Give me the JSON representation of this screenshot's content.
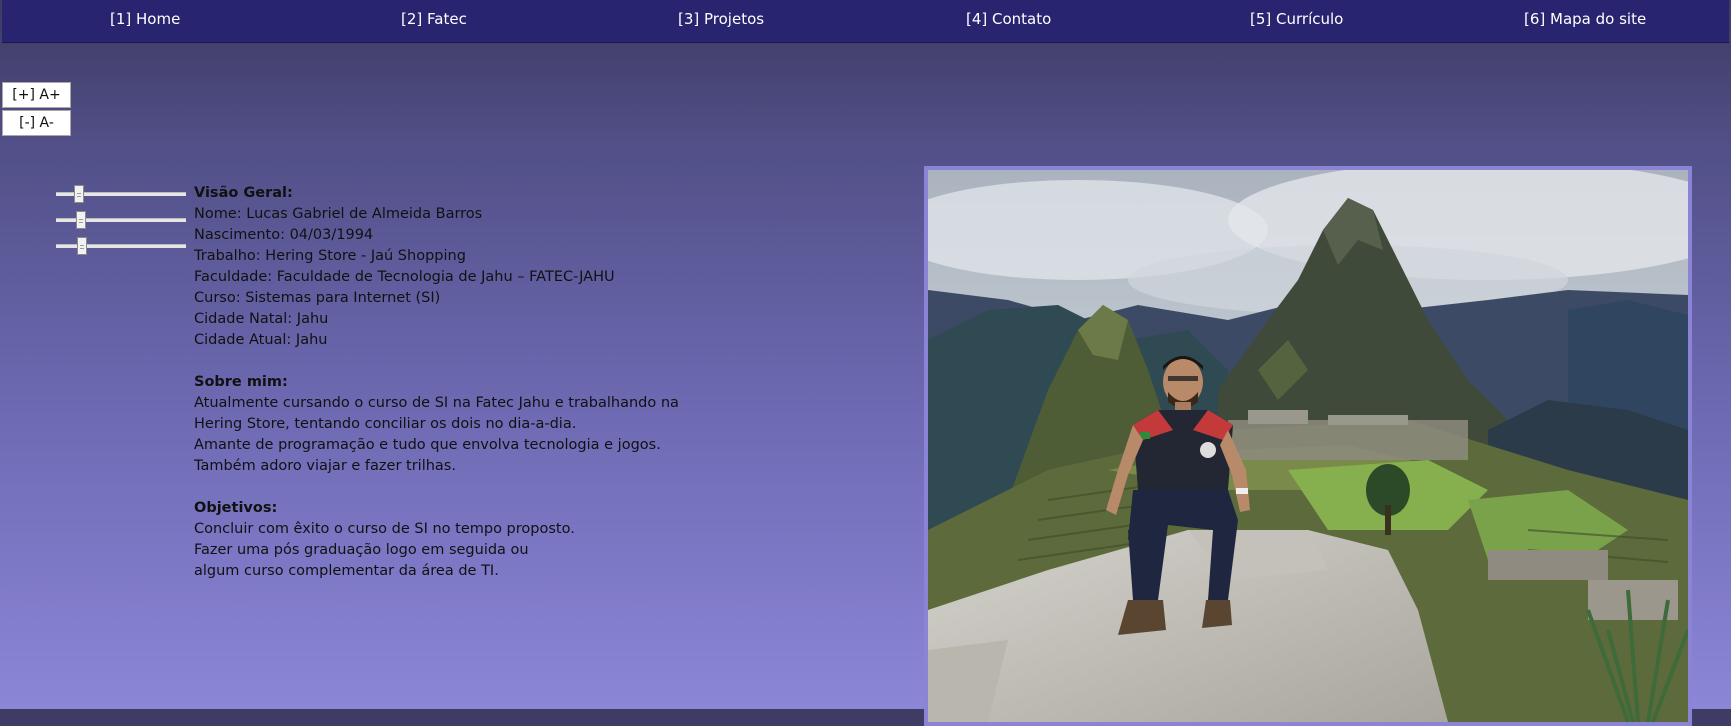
{
  "nav": {
    "items": [
      {
        "label": "[1] Home"
      },
      {
        "label": "[2] Fatec"
      },
      {
        "label": "[3] Projetos"
      },
      {
        "label": "[4] Contato"
      },
      {
        "label": "[5] Currículo"
      },
      {
        "label": "[6] Mapa do site"
      }
    ]
  },
  "font_controls": {
    "increase_label": "[+] A+",
    "decrease_label": "[-] A-"
  },
  "sliders": [
    {
      "value": 0.18
    },
    {
      "value": 0.19
    },
    {
      "value": 0.2
    }
  ],
  "overview": {
    "heading": "Visão Geral:",
    "lines": [
      "Nome: Lucas Gabriel de Almeida Barros",
      "Nascimento: 04/03/1994",
      "Trabalho: Hering Store - Jaú Shopping",
      "Faculdade: Faculdade de Tecnologia de Jahu – FATEC-JAHU",
      "Curso: Sistemas para Internet (SI)",
      "Cidade Natal: Jahu",
      "Cidade Atual: Jahu"
    ]
  },
  "about": {
    "heading": "Sobre mim:",
    "lines": [
      "Atualmente cursando o curso de SI na Fatec Jahu e trabalhando na",
      "Hering Store, tentando conciliar os dois no dia-a-dia.",
      "Amante de programação e tudo que envolva tecnologia e jogos.",
      "Também adoro viajar e fazer trilhas."
    ]
  },
  "goals": {
    "heading": "Objetivos:",
    "lines": [
      "Concluir com êxito o curso de SI no tempo proposto.",
      "Fazer uma pós graduação logo em seguida ou",
      "algum curso complementar da área de TI."
    ]
  },
  "colors": {
    "nav_background": "#282470",
    "photo_border": "#8b84d6",
    "page_gradient_top": "#3d3a63",
    "page_gradient_bottom": "#8c86d8"
  }
}
